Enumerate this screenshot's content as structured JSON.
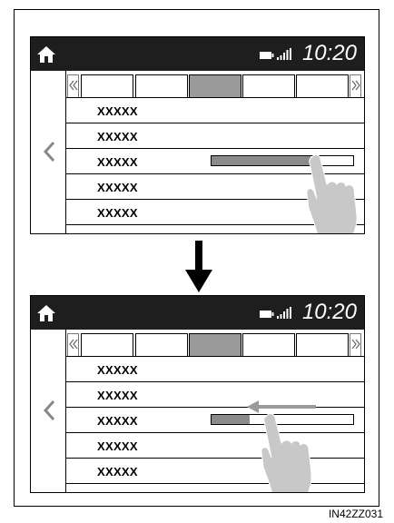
{
  "panels": [
    {
      "time": "10:20",
      "rows": [
        "XXXXX",
        "XXXXX",
        "XXXXX",
        "XXXXX",
        "XXXXX"
      ],
      "active_tab": 2,
      "slider_row": 2,
      "slider_level": 0.7,
      "swipe_arrow": false
    },
    {
      "time": "10:20",
      "rows": [
        "XXXXX",
        "XXXXX",
        "XXXXX",
        "XXXXX",
        "XXXXX"
      ],
      "active_tab": 2,
      "slider_row": 2,
      "slider_level": 0.27,
      "swipe_arrow": true
    }
  ],
  "icons": {
    "home": "home-icon",
    "battery": "battery-icon",
    "signal": "signal-icon",
    "back": "chevron-left-icon",
    "tab_prev": "double-chevron-left-icon",
    "tab_next": "double-chevron-right-icon",
    "hand": "hand-pointer-icon",
    "swipe": "arrow-left-icon",
    "transition": "arrow-down-icon"
  },
  "colors": {
    "statusbar": "#1e1e1e",
    "active_tab": "#9a9a9a",
    "slider_fill": "#8a8a8a",
    "hand": "#c8c8c8"
  },
  "caption": "IN42ZZ031"
}
